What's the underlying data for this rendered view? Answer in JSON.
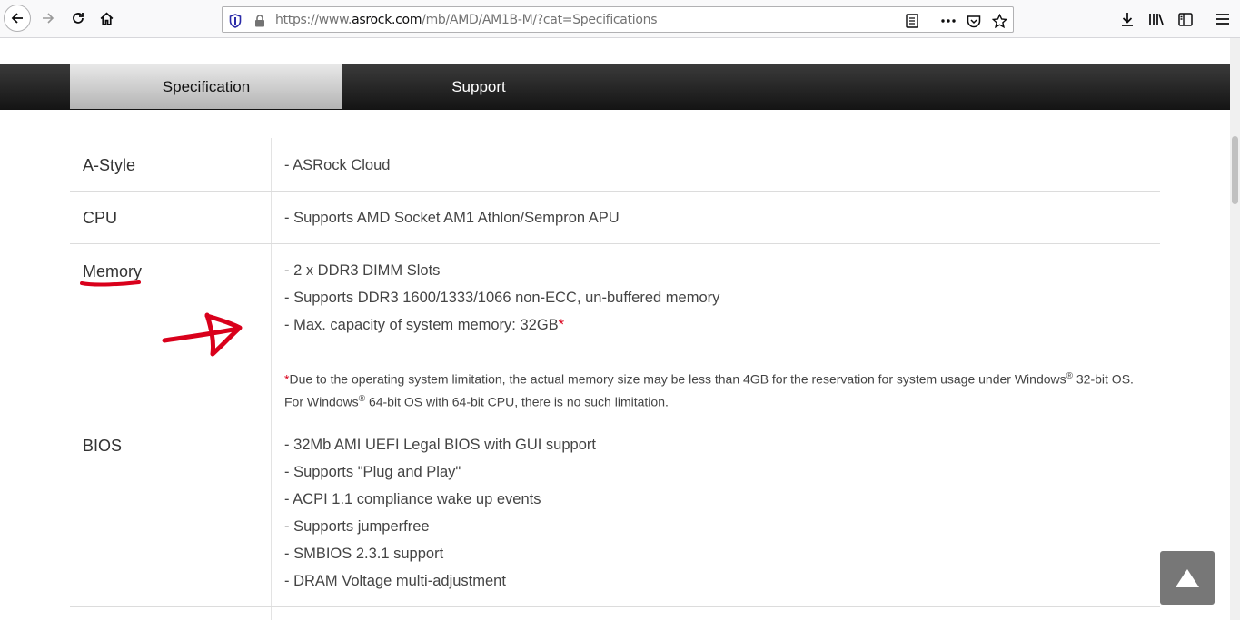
{
  "browser": {
    "url_prefix": "https://www.",
    "url_domain": "asrock.com",
    "url_path": "/mb/AMD/AM1B-M/?cat=Specifications",
    "icons": [
      "back-icon",
      "forward-icon",
      "reload-icon",
      "home-icon",
      "shield-icon",
      "lock-icon",
      "reader-view-icon",
      "more-icon",
      "pocket-icon",
      "bookmark-star-icon",
      "download-icon",
      "library-icon",
      "sidebar-icon",
      "menu-icon"
    ]
  },
  "nav": {
    "tabs": [
      {
        "label": "Specification",
        "active": true
      },
      {
        "label": "Support",
        "active": false
      }
    ]
  },
  "specs": {
    "astyle": {
      "label": "A-Style",
      "items": [
        "- ASRock Cloud"
      ]
    },
    "cpu": {
      "label": "CPU",
      "items": [
        "- Supports AMD Socket AM1 Athlon/Sempron APU"
      ]
    },
    "memory": {
      "label": "Memory",
      "items": [
        "- 2 x DDR3 DIMM Slots",
        "- Supports DDR3 1600/1333/1066 non-ECC, un-buffered memory",
        "- Max. capacity of system memory: 32GB"
      ],
      "asterisk": "*",
      "note_part1": "Due to the operating system limitation, the actual memory size may be less than 4GB for the reservation for system usage under Windows",
      "note_reg": "®",
      "note_part2": " 32-bit OS. For Windows",
      "note_part3": " 64-bit OS with 64-bit CPU, there is no such limitation."
    },
    "bios": {
      "label": "BIOS",
      "items": [
        "- 32Mb AMI UEFI Legal BIOS with GUI support",
        "- Supports \"Plug and Play\"",
        "- ACPI 1.1 compliance wake up events",
        "- Supports jumperfree",
        "- SMBIOS 2.3.1 support",
        "- DRAM Voltage multi-adjustment"
      ]
    }
  },
  "annotation_color": "#d9001b",
  "accent_color": "#777777"
}
